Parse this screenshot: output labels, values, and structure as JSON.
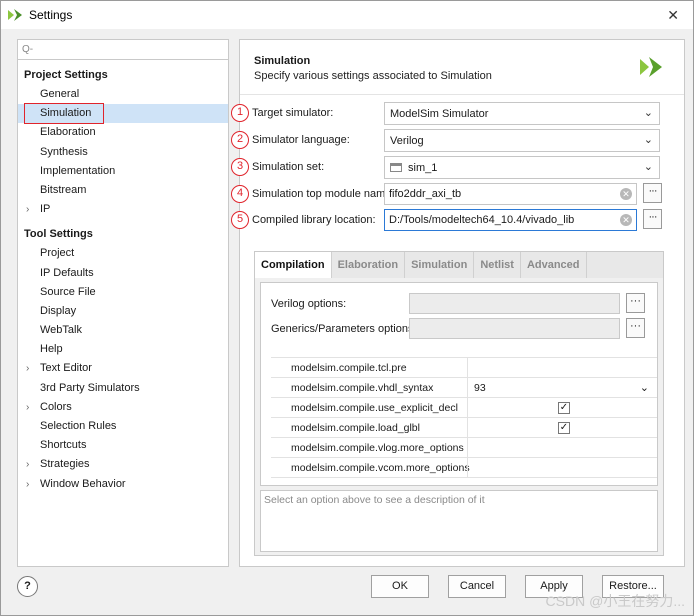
{
  "window": {
    "title": "Settings",
    "close": "✕"
  },
  "search": {
    "placeholder": "Q-"
  },
  "nav": {
    "project_section": "Project Settings",
    "project_items": [
      "General",
      "Simulation",
      "Elaboration",
      "Synthesis",
      "Implementation",
      "Bitstream",
      "IP"
    ],
    "tool_section": "Tool Settings",
    "tool_items": [
      "Project",
      "IP Defaults",
      "Source File",
      "Display",
      "WebTalk",
      "Help",
      "Text Editor",
      "3rd Party Simulators",
      "Colors",
      "Selection Rules",
      "Shortcuts",
      "Strategies",
      "Window Behavior"
    ],
    "selected": "Simulation"
  },
  "header": {
    "title": "Simulation",
    "subtitle": "Specify various settings associated to Simulation"
  },
  "form": {
    "markers": [
      "1",
      "2",
      "3",
      "4",
      "5"
    ],
    "target_simulator_label": "Target simulator:",
    "target_simulator_value": "ModelSim Simulator",
    "language_label": "Simulator language:",
    "language_value": "Verilog",
    "sim_set_label": "Simulation set:",
    "sim_set_value": "sim_1",
    "top_module_label": "Simulation top module name:",
    "top_module_value": "fifo2ddr_axi_tb",
    "compiled_lib_label": "Compiled library location:",
    "compiled_lib_value": "D:/Tools/modeltech64_10.4/vivado_lib",
    "browse": "···"
  },
  "tabs": [
    "Compilation",
    "Elaboration",
    "Simulation",
    "Netlist",
    "Advanced"
  ],
  "compilation": {
    "verilog_options_label": "Verilog options:",
    "generics_label": "Generics/Parameters options:",
    "properties": [
      {
        "name": "modelsim.compile.tcl.pre",
        "value": "",
        "type": "text"
      },
      {
        "name": "modelsim.compile.vhdl_syntax",
        "value": "93",
        "type": "select"
      },
      {
        "name": "modelsim.compile.use_explicit_decl",
        "value": "✓",
        "type": "check"
      },
      {
        "name": "modelsim.compile.load_glbl",
        "value": "✓",
        "type": "check"
      },
      {
        "name": "modelsim.compile.vlog.more_options",
        "value": "",
        "type": "text"
      },
      {
        "name": "modelsim.compile.vcom.more_options",
        "value": "",
        "type": "text"
      }
    ],
    "description": "Select an option above to see a description of it"
  },
  "buttons": {
    "help": "?",
    "ok": "OK",
    "cancel": "Cancel",
    "apply": "Apply",
    "restore": "Restore..."
  },
  "watermark": "CSDN @小王在努力...",
  "colors": {
    "accent_red": "#e0242c",
    "selected_bg": "#cfe3f7",
    "logo_green": "#8cc63f"
  }
}
